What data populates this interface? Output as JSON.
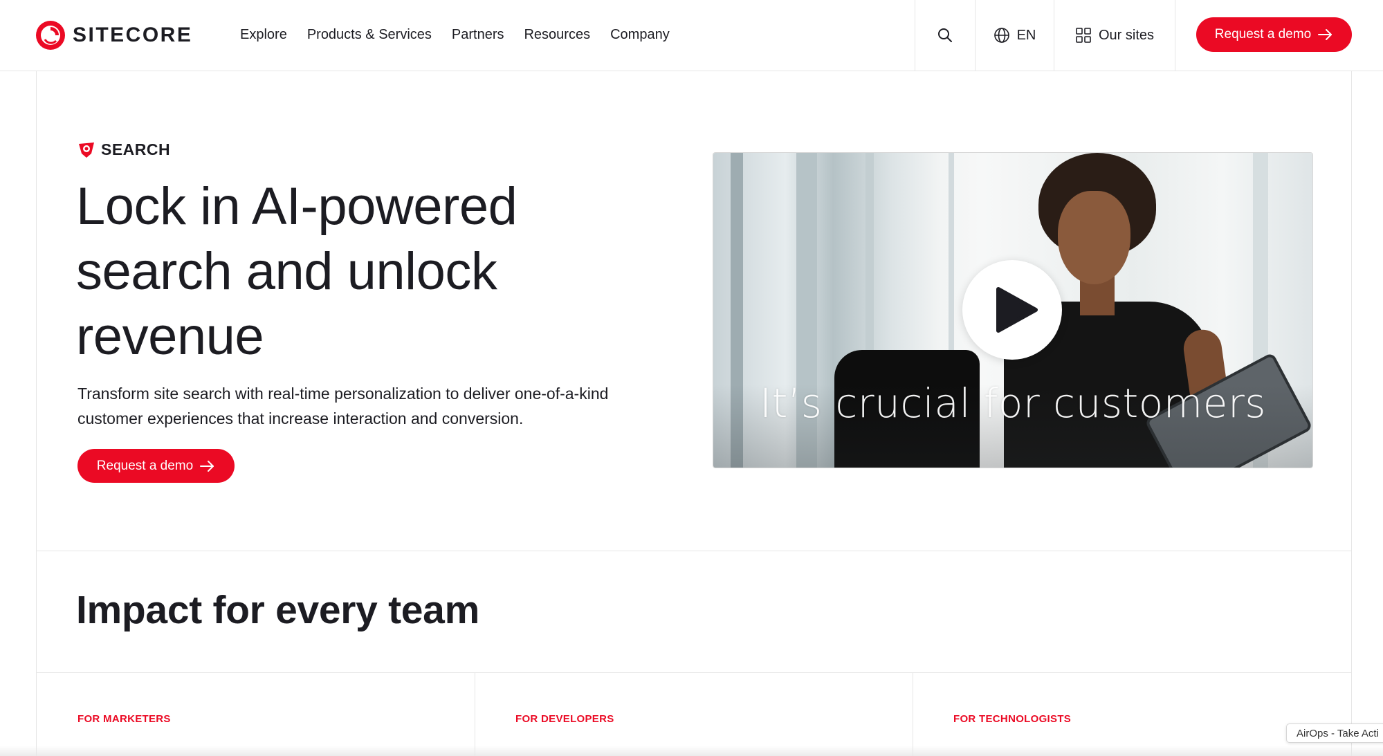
{
  "header": {
    "logo_text": "SITECORE",
    "nav": [
      "Explore",
      "Products & Services",
      "Partners",
      "Resources",
      "Company"
    ],
    "language": "EN",
    "our_sites": "Our sites",
    "demo_label": "Request a demo"
  },
  "hero": {
    "eyebrow": "SEARCH",
    "title": "Lock in AI-powered search and unlock revenue",
    "description": "Transform site search with real-time personalization to deliver one-of-a-kind customer experiences that increase interaction and conversion.",
    "demo_label": "Request a demo",
    "video_caption": "It’s crucial for customers"
  },
  "impact": {
    "title": "Impact for every team",
    "teams": [
      "FOR MARKETERS",
      "FOR DEVELOPERS",
      "FOR TECHNOLOGISTS"
    ]
  },
  "airops_tab": "AirOps - Take Acti",
  "colors": {
    "brand_red": "#eb0a24",
    "text": "#1c1c22",
    "divider": "#e6e6e6"
  },
  "icons": [
    "sitecore-logo-icon",
    "search-icon",
    "globe-icon",
    "grid-icon",
    "arrow-right-icon",
    "search-product-icon",
    "play-icon"
  ]
}
